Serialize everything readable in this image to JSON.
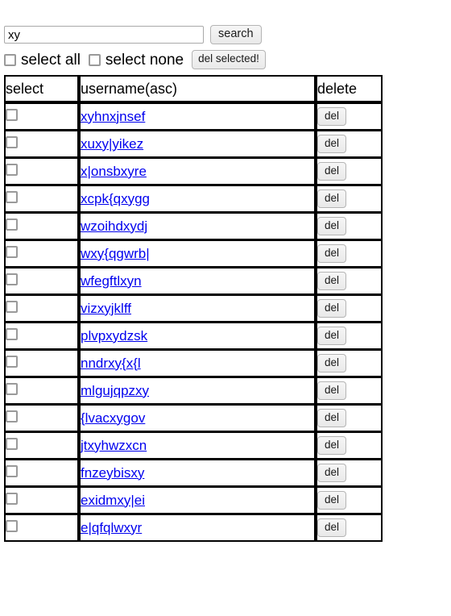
{
  "search": {
    "value": "xy",
    "placeholder": "",
    "button_label": "search"
  },
  "bulk_actions": {
    "select_all_label": "select all",
    "select_none_label": "select none",
    "select_all_checked": false,
    "select_none_checked": false,
    "delete_selected_label": "del selected!"
  },
  "table": {
    "columns": [
      "select",
      "username(asc)",
      "delete"
    ],
    "row_delete_label": "del",
    "rows": [
      {
        "username": "xyhnxjnsef",
        "selected": false
      },
      {
        "username": "xuxy|yikez",
        "selected": false
      },
      {
        "username": "x|onsbxyre",
        "selected": false
      },
      {
        "username": "xcpk{qxygg",
        "selected": false
      },
      {
        "username": "wzoihdxydj",
        "selected": false
      },
      {
        "username": "wxy{qgwrb|",
        "selected": false
      },
      {
        "username": "wfegftlxyn",
        "selected": false
      },
      {
        "username": "vizxyjklff",
        "selected": false
      },
      {
        "username": "plvpxydzsk",
        "selected": false
      },
      {
        "username": "nndrxy{x{l",
        "selected": false
      },
      {
        "username": "mlgujqpzxy",
        "selected": false
      },
      {
        "username": "{lvacxygov",
        "selected": false
      },
      {
        "username": "jtxyhwzxcn",
        "selected": false
      },
      {
        "username": "fnzeybisxy",
        "selected": false
      },
      {
        "username": "exidmxy|ei",
        "selected": false
      },
      {
        "username": "e|qfqlwxyr",
        "selected": false
      }
    ]
  },
  "colors": {
    "link": "#0000ee",
    "border": "#000000",
    "button_face": "#efefef",
    "checkbox_border": "#9a9a9a"
  }
}
